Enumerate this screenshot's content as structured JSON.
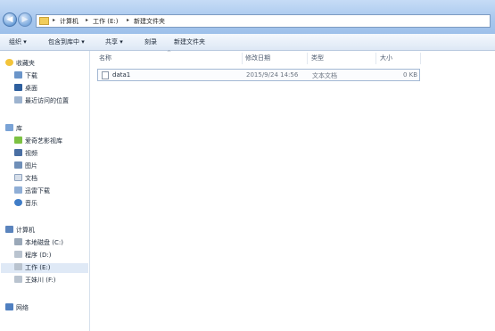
{
  "breadcrumb": {
    "root": "计算机",
    "drive": "工作 (E:)",
    "folder": "新建文件夹"
  },
  "toolbar": {
    "organize": "组织 ▾",
    "include": "包含到库中 ▾",
    "share": "共享 ▾",
    "burn": "刻录",
    "new_folder": "新建文件夹"
  },
  "nav": {
    "favorites": {
      "title": "收藏夹",
      "items": [
        "下载",
        "桌面",
        "最近访问的位置"
      ]
    },
    "libraries": {
      "title": "库",
      "items": [
        "爱奇艺影视库",
        "视频",
        "图片",
        "文档",
        "迅雷下载",
        "音乐"
      ]
    },
    "computer": {
      "title": "计算机",
      "items": [
        "本地磁盘 (C:)",
        "程序 (D:)",
        "工作 (E:)",
        "王妹川 (F:)"
      ]
    },
    "network": {
      "title": "网络"
    }
  },
  "columns": {
    "name": "名称",
    "date": "修改日期",
    "type": "类型",
    "size": "大小"
  },
  "files": [
    {
      "name": "data1",
      "date": "2015/9/24 14:56",
      "type": "文本文档",
      "size": "0 KB"
    }
  ]
}
